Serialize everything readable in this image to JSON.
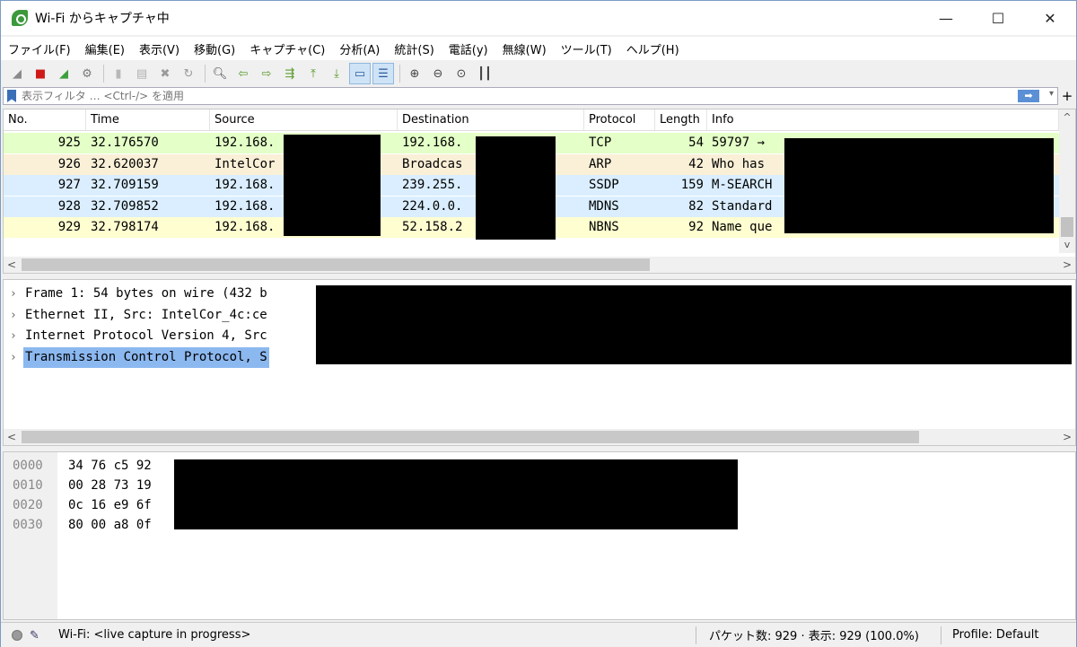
{
  "window": {
    "title": "Wi-Fi からキャプチャ中",
    "minimize": "—",
    "maximize": "☐",
    "close": "✕"
  },
  "menu": [
    "ファイル(F)",
    "編集(E)",
    "表示(V)",
    "移動(G)",
    "キャプチャ(C)",
    "分析(A)",
    "統計(S)",
    "電話(y)",
    "無線(W)",
    "ツール(T)",
    "ヘルプ(H)"
  ],
  "toolbar": [
    {
      "name": "start-capture-icon",
      "glyph": "◢",
      "color": "#8a8a8a"
    },
    {
      "name": "stop-capture-icon",
      "glyph": "■",
      "color": "#d01818"
    },
    {
      "name": "restart-capture-icon",
      "glyph": "◢",
      "color": "#3ca03c"
    },
    {
      "name": "capture-options-icon",
      "glyph": "⚙",
      "color": "#7a7a7a"
    },
    {
      "sep": true
    },
    {
      "name": "open-file-icon",
      "glyph": "▮",
      "color": "#b8b8b8"
    },
    {
      "name": "save-file-icon",
      "glyph": "▤",
      "color": "#b0b0b0"
    },
    {
      "name": "close-file-icon",
      "glyph": "✖",
      "color": "#9a9a9a"
    },
    {
      "name": "reload-icon",
      "glyph": "↻",
      "color": "#9a9a9a"
    },
    {
      "sep": true
    },
    {
      "name": "find-packet-icon",
      "glyph": "🔍︎",
      "color": "#444"
    },
    {
      "name": "go-back-icon",
      "glyph": "⇦",
      "color": "#5a9a2a"
    },
    {
      "name": "go-forward-icon",
      "glyph": "⇨",
      "color": "#5a9a2a"
    },
    {
      "name": "go-to-packet-icon",
      "glyph": "⇶",
      "color": "#5a9a2a"
    },
    {
      "name": "go-first-icon",
      "glyph": "⤒",
      "color": "#5a9a2a"
    },
    {
      "name": "go-last-icon",
      "glyph": "⤓",
      "color": "#5a9a2a"
    },
    {
      "name": "autoscroll-icon",
      "glyph": "▭",
      "color": "#2a5aa0",
      "active": true
    },
    {
      "name": "colorize-icon",
      "glyph": "☰",
      "color": "#2a5aa0",
      "active": true
    },
    {
      "sep": true
    },
    {
      "name": "zoom-in-icon",
      "glyph": "⊕",
      "color": "#444"
    },
    {
      "name": "zoom-out-icon",
      "glyph": "⊖",
      "color": "#444"
    },
    {
      "name": "zoom-normal-icon",
      "glyph": "⊙",
      "color": "#444"
    },
    {
      "name": "resize-columns-icon",
      "glyph": "┃┃",
      "color": "#444"
    }
  ],
  "filter": {
    "placeholder": "表示フィルタ … <Ctrl-/> を適用",
    "apply_glyph": "➡",
    "dropdown_glyph": "▾",
    "plus_glyph": "+"
  },
  "packet_list": {
    "columns": [
      "No.",
      "Time",
      "Source",
      "Destination",
      "Protocol",
      "Length",
      "Info"
    ],
    "rows": [
      {
        "no": "925",
        "time": "32.176570",
        "source": "192.168.",
        "destination": "192.168.",
        "protocol": "TCP",
        "length": "54",
        "info": "59797 →",
        "bg": "#e4ffc7"
      },
      {
        "no": "926",
        "time": "32.620037",
        "source": "IntelCor",
        "destination": "Broadcas",
        "protocol": "ARP",
        "length": "42",
        "info": "Who has",
        "bg": "#faf0d7"
      },
      {
        "no": "927",
        "time": "32.709159",
        "source": "192.168.",
        "destination": "239.255.",
        "protocol": "SSDP",
        "length": "159",
        "info": "M-SEARCH",
        "bg": "#daeeff"
      },
      {
        "no": "928",
        "time": "32.709852",
        "source": "192.168.",
        "destination": "224.0.0.",
        "protocol": "MDNS",
        "length": "82",
        "info": "Standard",
        "bg": "#daeeff"
      },
      {
        "no": "929",
        "time": "32.798174",
        "source": "192.168.",
        "destination": "52.158.2",
        "protocol": "NBNS",
        "length": "92",
        "info": "Name que",
        "bg": "#fefed0"
      }
    ]
  },
  "details": [
    {
      "text": "Frame 1: 54 bytes on wire (432 b",
      "selected": false
    },
    {
      "text": "Ethernet II, Src: IntelCor_4c:ce",
      "selected": false
    },
    {
      "text": "Internet Protocol Version 4, Src",
      "selected": false
    },
    {
      "text": "Transmission Control Protocol, S",
      "selected": true
    }
  ],
  "bytes": {
    "offsets": [
      "0000",
      "0010",
      "0020",
      "0030"
    ],
    "hex": [
      "34 76 c5 92",
      "00 28 73 19",
      "0c 16 e9 6f",
      "80 00 a8 0f"
    ]
  },
  "status": {
    "interface": "Wi-Fi: <live capture in progress>",
    "packets": "パケット数: 929 · 表示: 929 (100.0%)",
    "profile": "Profile: Default"
  },
  "scroll": {
    "left": "<",
    "right": ">",
    "up": "^",
    "down": "v"
  }
}
